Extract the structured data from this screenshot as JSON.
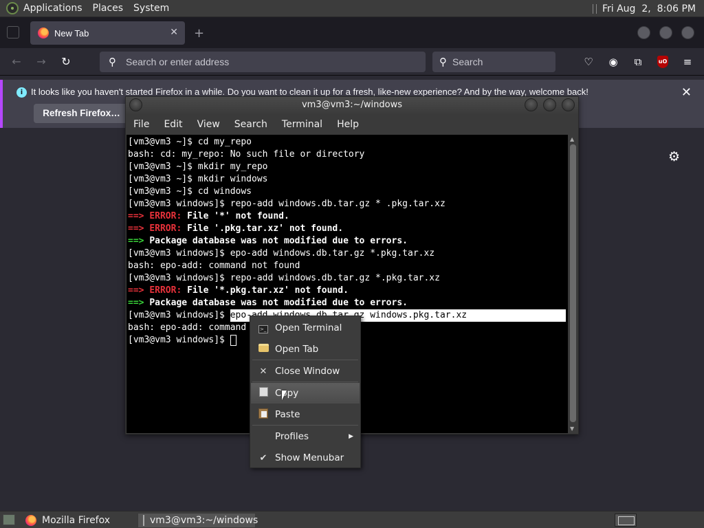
{
  "top_panel": {
    "menus": [
      "Applications",
      "Places",
      "System"
    ],
    "clock": "Fri Aug  2,  8:06 PM"
  },
  "firefox": {
    "tab_title": "New Tab",
    "url_placeholder": "Search or enter address",
    "search_placeholder": "Search",
    "ublock_label": "uO",
    "notification": {
      "message": "It looks like you haven't started Firefox in a while. Do you want to clean it up for a fresh, like-new experience? And by the way, welcome back!",
      "button": "Refresh Firefox…"
    }
  },
  "terminal": {
    "title": "vm3@vm3:~/windows",
    "menu": [
      "File",
      "Edit",
      "View",
      "Search",
      "Terminal",
      "Help"
    ],
    "lines": {
      "l1": "[vm3@vm3 ~]$ cd my_repo",
      "l2": "bash: cd: my_repo: No such file or directory",
      "l3": "[vm3@vm3 ~]$ mkdir my_repo",
      "l4": "[vm3@vm3 ~]$ mkdir windows",
      "l5": "[vm3@vm3 ~]$ cd windows",
      "l6": "[vm3@vm3 windows]$ repo-add windows.db.tar.gz * .pkg.tar.xz",
      "l7_arrow": "==> ",
      "l7_err": "ERROR:",
      "l7_msg": " File '*' not found.",
      "l8_arrow": "==> ",
      "l8_err": "ERROR:",
      "l8_msg": " File '.pkg.tar.xz' not found.",
      "l9_arrow": "==> ",
      "l9_msg": "Package database was not modified due to errors.",
      "l10": "[vm3@vm3 windows]$ epo-add windows.db.tar.gz *.pkg.tar.xz",
      "l11": "bash: epo-add: command not found",
      "l12": "[vm3@vm3 windows]$ repo-add windows.db.tar.gz *.pkg.tar.xz",
      "l13_arrow": "==> ",
      "l13_err": "ERROR:",
      "l13_msg": " File '*.pkg.tar.xz' not found.",
      "l14_arrow": "==> ",
      "l14_msg": "Package database was not modified due to errors.",
      "l15_prompt": "[vm3@vm3 windows]$ ",
      "l15_selected": "epo-add windows.db.tar.gz windows.pkg.tar.xz",
      "l16": "bash: epo-add: command",
      "l17_prompt": "[vm3@vm3 windows]$ "
    }
  },
  "context_menu": {
    "items": [
      {
        "label": "Open Terminal",
        "icon": "terminal-icon"
      },
      {
        "label": "Open Tab",
        "icon": "folder-icon"
      },
      {
        "label": "Close Window",
        "icon": "close-icon"
      },
      {
        "label": "Copy",
        "icon": "copy-icon"
      },
      {
        "label": "Paste",
        "icon": "paste-icon"
      },
      {
        "label": "Profiles",
        "icon": "submenu-arrow-icon"
      },
      {
        "label": "Show Menubar",
        "icon": "checkmark-icon"
      }
    ],
    "hovered": "Copy"
  },
  "bottom_panel": {
    "tasks": [
      "Mozilla Firefox",
      "vm3@vm3:~/windows"
    ]
  },
  "colors": {
    "error_red": "#e8313a",
    "arrow_green": "#39d339",
    "notification_accent": "#b547ff"
  }
}
